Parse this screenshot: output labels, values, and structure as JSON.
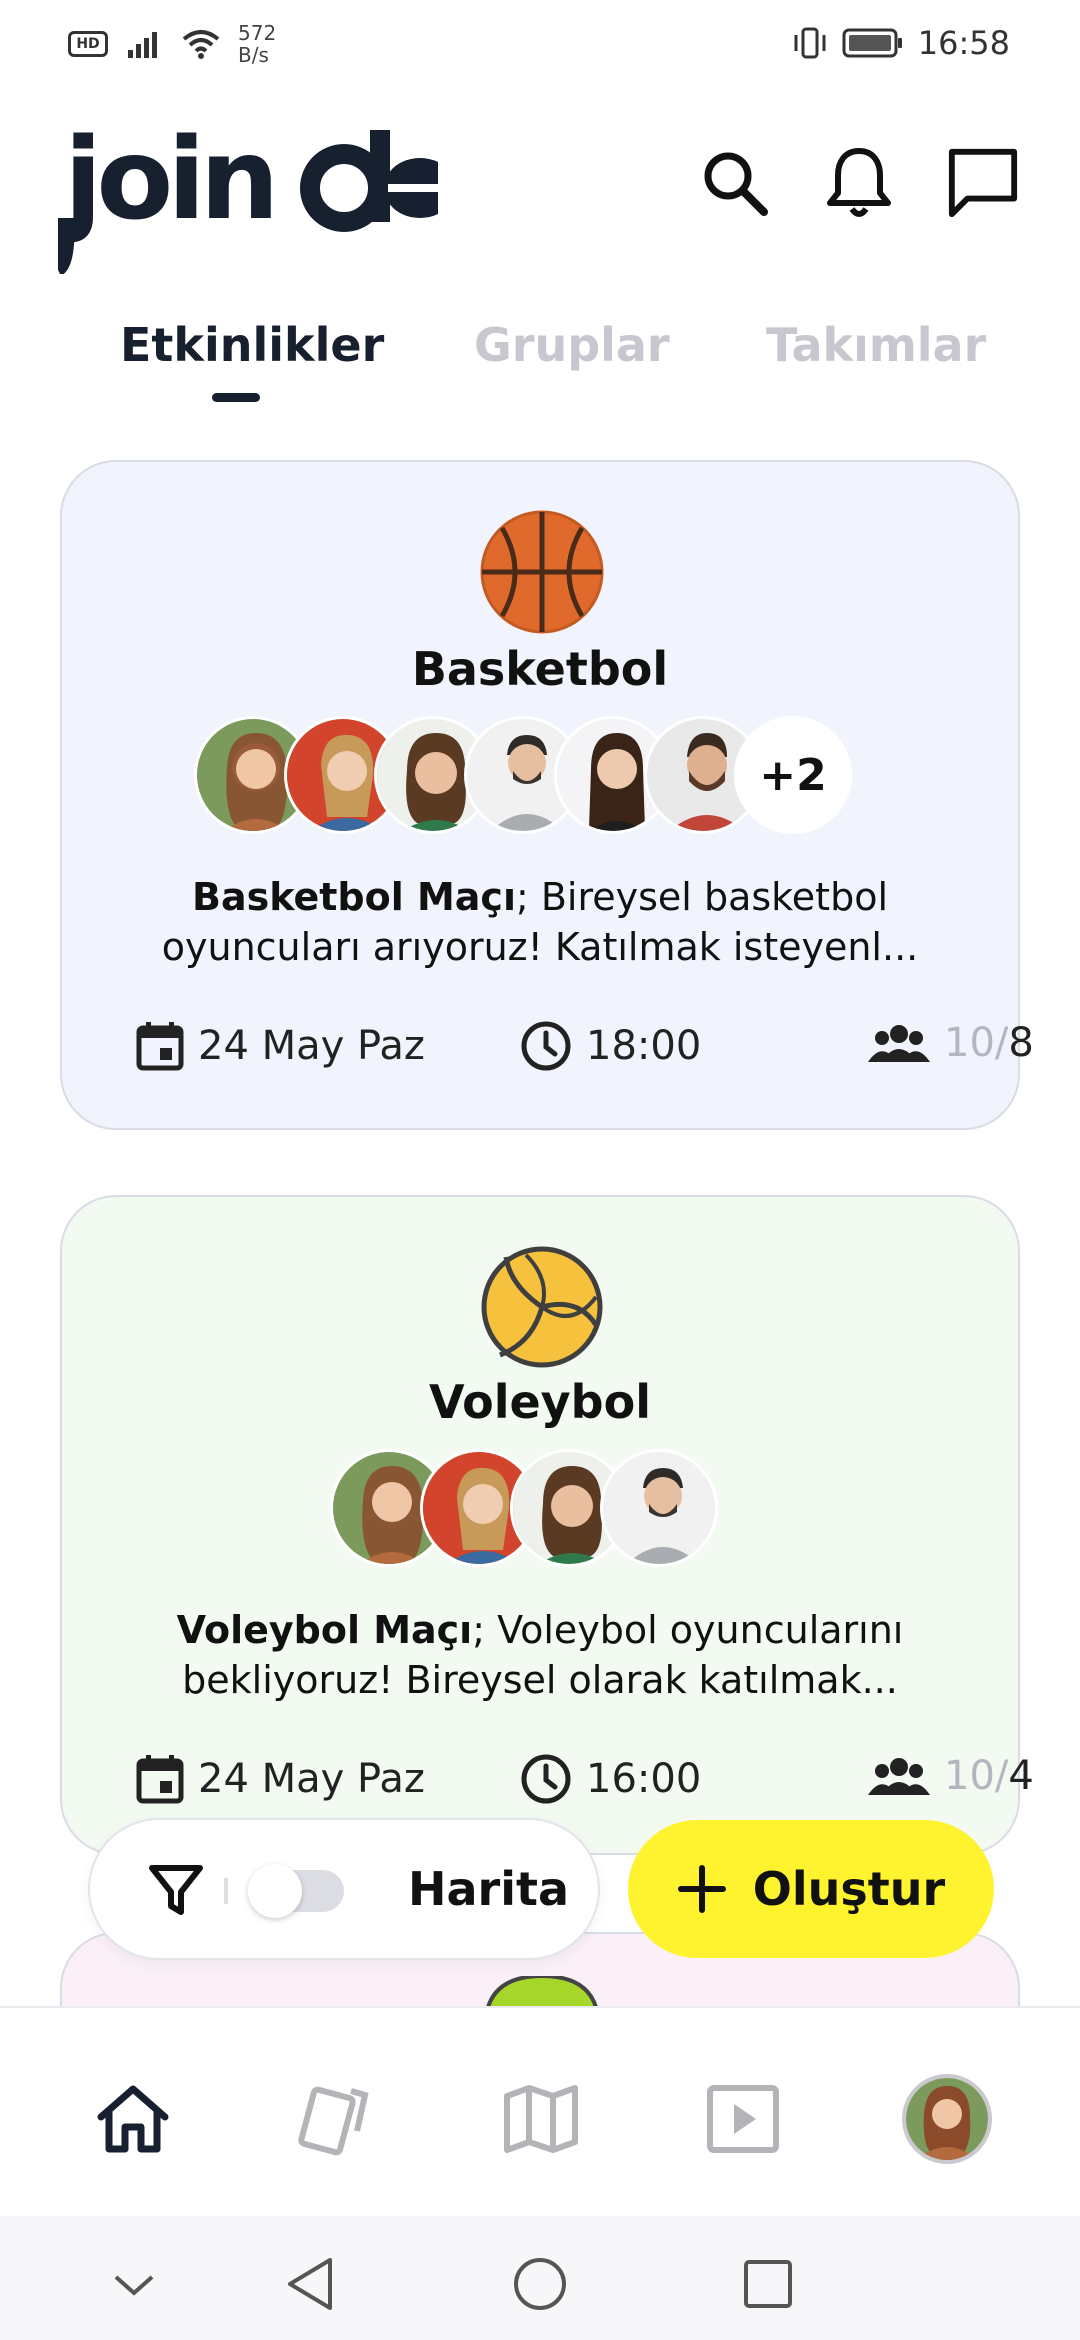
{
  "status_bar": {
    "hd": "HD",
    "speed_value": "572",
    "speed_unit": "B/s",
    "time": "16:58",
    "icons": [
      "signal-icon",
      "wifi-icon",
      "vibrate-icon",
      "battery-icon"
    ]
  },
  "header": {
    "logo_text": "join",
    "icons": [
      "search-icon",
      "bell-icon",
      "chat-icon"
    ]
  },
  "tabs": [
    {
      "label": "Etkinlikler",
      "active": true
    },
    {
      "label": "Gruplar",
      "active": false
    },
    {
      "label": "Takımlar",
      "active": false
    }
  ],
  "events": [
    {
      "sport": "Basketbol",
      "ball_icon": "basketball-icon",
      "extra_participants": "+2",
      "desc_bold": "Basketbol Maçı",
      "desc_rest": "; Bireysel basketbol oyuncuları arıyoruz! Katılmak isteyenl...",
      "date": "24 May Paz",
      "time": "18:00",
      "capacity_current": "10",
      "capacity_sep": "/",
      "capacity_total": "8",
      "bg_color": "#f1f4fd"
    },
    {
      "sport": "Voleybol",
      "ball_icon": "volleyball-icon",
      "desc_bold": "Voleybol Maçı",
      "desc_rest": "; Voleybol oyuncularını bekliyoruz! Bireysel olarak katılmak...",
      "date": "24 May Paz",
      "time": "16:00",
      "capacity_current": "10",
      "capacity_sep": "/",
      "capacity_total": "4",
      "bg_color": "#f2faf2"
    }
  ],
  "controls": {
    "map_label": "Harita",
    "map_toggle_on": false,
    "create_label": "Oluştur",
    "create_color": "#fff22f"
  },
  "bottom_nav": [
    "home-icon",
    "cards-icon",
    "map-icon",
    "play-icon",
    "profile-avatar"
  ],
  "system_nav": [
    "collapse-icon",
    "back-icon",
    "home-circle-icon",
    "recents-icon"
  ],
  "colors": {
    "primary_dark": "#17202e",
    "inactive_tab": "#c7c8cf",
    "accent_yellow": "#fff22f"
  }
}
